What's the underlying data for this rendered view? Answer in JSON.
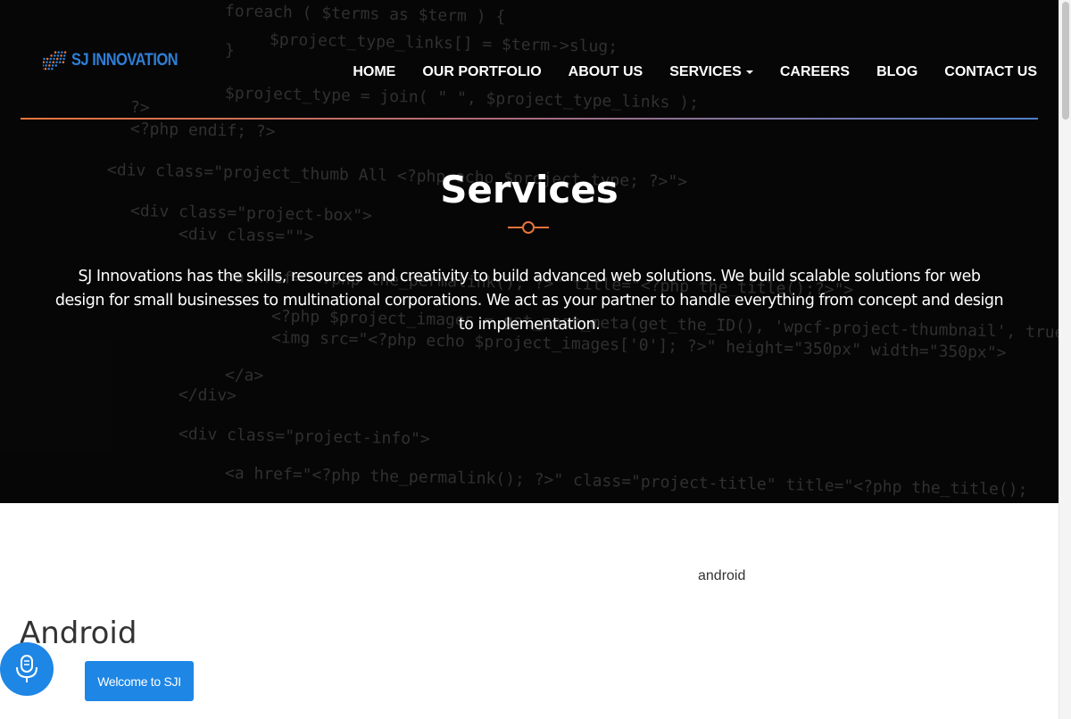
{
  "brand": {
    "logo_text": "SJ INNOVATION",
    "colors": {
      "blue": "#2e7fd6",
      "orange": "#e8743b"
    }
  },
  "nav": {
    "items": [
      {
        "label": "HOME"
      },
      {
        "label": "OUR PORTFOLIO"
      },
      {
        "label": "ABOUT US"
      },
      {
        "label": "SERVICES",
        "dropdown": true
      },
      {
        "label": "CAREERS"
      },
      {
        "label": "BLOG"
      },
      {
        "label": "CONTACT US"
      }
    ]
  },
  "hero": {
    "title": "Services",
    "description": "SJ Innovations has the skills, resources and creativity to build advanced web solutions. We build scalable solutions for web design for small businesses to multinational corporations. We act as your partner to handle everything from concept and design to implementation.",
    "background_code": [
      "foreach ( $terms as $term ) {",
      "    $project_type_links[] = $term->slug;",
      "}",
      "$project_type = join( \" \", $project_type_links );",
      "?>",
      "<?php endif; ?>",
      "<div class=\"project_thumb All <?php echo $project_type; ?>\">",
      "<div class=\"project-box\">",
      "    <div class=\"\">",
      "        <a href=\"<?php the_permalink(); ?>\" title=\"<?php the_title();?>\">",
      "            <?php $project_images = get_post_meta(get_the_ID(), 'wpcf-project-thumbnail', true);",
      "            <img src=\"<?php echo $project_images['0']; ?>\" height=\"350px\" width=\"350px\">",
      "        </a>",
      "    </div>",
      "    <div class=\"project-info\">",
      "        <a href=\"<?php the_permalink(); ?>\" class=\"project-title\" title=\"<?php the_title();"
    ]
  },
  "content": {
    "image_alt": "android",
    "heading": "Android"
  },
  "widgets": {
    "mic_icon": "microphone-icon",
    "welcome_label": "Welcome to SJI",
    "accent": "#1e86e5"
  }
}
